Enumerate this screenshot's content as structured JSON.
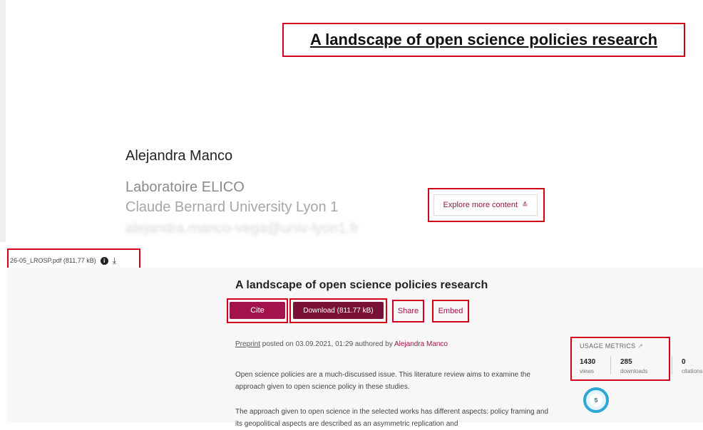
{
  "preview": {
    "title": "A landscape of open science policies research",
    "author": "Alejandra Manco",
    "affiliation": "Laboratoire ELICO",
    "university": "Claude Bernard University Lyon 1",
    "email": "alejandra.manco-vega@univ-lyon1.fr",
    "explore_label": "Explore more content",
    "explore_icon": "double-chevron-down-icon"
  },
  "file": {
    "name": "26-05_LROSP.pdf",
    "size": "(811.77 kB)",
    "info_icon": "info-icon",
    "download_icon": "download-icon"
  },
  "item": {
    "title": "A landscape of open science policies research",
    "cite_label": "Cite",
    "download_label": "Download (811.77 kB)",
    "share_label": "Share",
    "embed_label": "Embed",
    "posted_type": "Preprint",
    "posted_text": " posted on 03.09.2021, 01:29 authored by ",
    "posted_author": "Alejandra Manco",
    "paragraph1": "Open science policies are a much-discussed issue. This literature review aims to examine the approach given to open science policy in these studies.",
    "paragraph2": "The approach given to open science in the selected works has different aspects: policy framing and its geopolitical aspects are described as an asymmetric replication and"
  },
  "metrics": {
    "heading": "USAGE METRICS",
    "views_value": "1430",
    "views_label": "views",
    "downloads_value": "285",
    "downloads_label": "downloads",
    "citations_value": "0",
    "citations_label": "citations",
    "altmetric_score": "5"
  },
  "colors": {
    "accent": "#a3124a",
    "download_button": "#7a1238",
    "highlight_box": "#d0021b",
    "altmetric_ring": "#31a6d4"
  }
}
